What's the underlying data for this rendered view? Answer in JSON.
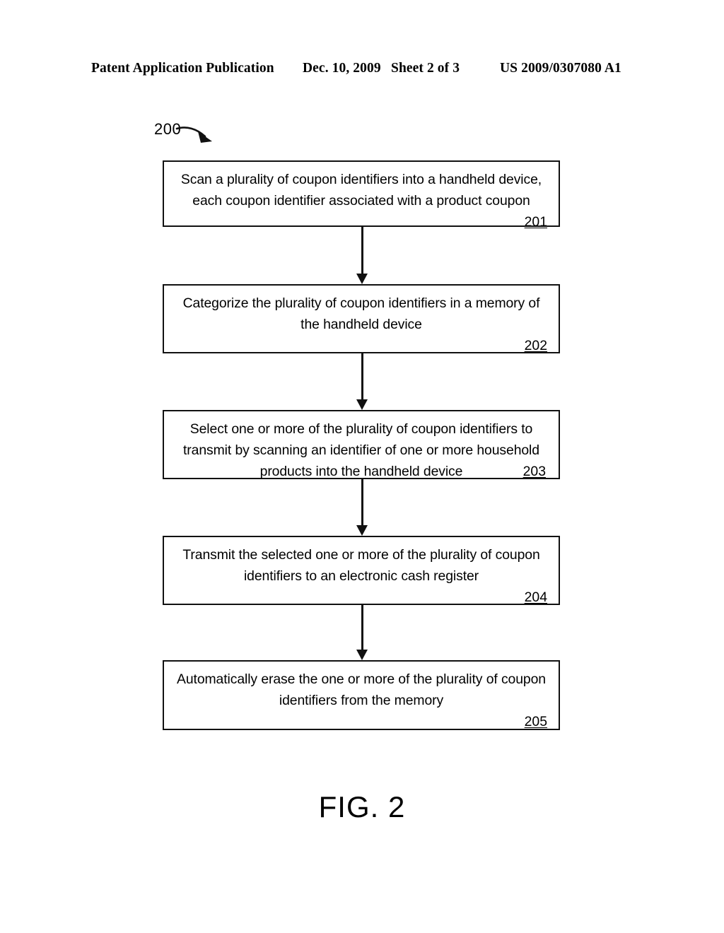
{
  "header": {
    "publication": "Patent Application Publication",
    "date": "Dec. 10, 2009",
    "sheet": "Sheet 2 of 3",
    "patent_number": "US 2009/0307080 A1"
  },
  "figure": {
    "reference_numeral": "200",
    "caption": "FIG. 2",
    "arrow_icon": "curved-arrow-icon"
  },
  "flow": {
    "nodes": [
      {
        "id": "201",
        "text": "Scan a plurality of coupon identifiers into a handheld device, each coupon identifier associated with a product coupon",
        "ref": "201"
      },
      {
        "id": "202",
        "text": "Categorize the plurality of coupon identifiers in a memory of the handheld device",
        "ref": "202"
      },
      {
        "id": "203",
        "text": "Select one or more of the plurality of coupon identifiers to transmit by scanning an identifier of one or more household products into the handheld device",
        "ref": "203"
      },
      {
        "id": "204",
        "text": "Transmit the selected one or more of the plurality of coupon identifiers to an electronic cash register",
        "ref": "204"
      },
      {
        "id": "205",
        "text": "Automatically erase the one or more of the plurality of coupon identifiers from the memory",
        "ref": "205"
      }
    ],
    "connectors": [
      {
        "from": "201",
        "to": "202",
        "icon": "down-arrow-icon"
      },
      {
        "from": "202",
        "to": "203",
        "icon": "down-arrow-icon"
      },
      {
        "from": "203",
        "to": "204",
        "icon": "down-arrow-icon"
      },
      {
        "from": "204",
        "to": "205",
        "icon": "down-arrow-icon"
      }
    ]
  },
  "colors": {
    "ink": "#111111",
    "page": "#ffffff"
  }
}
